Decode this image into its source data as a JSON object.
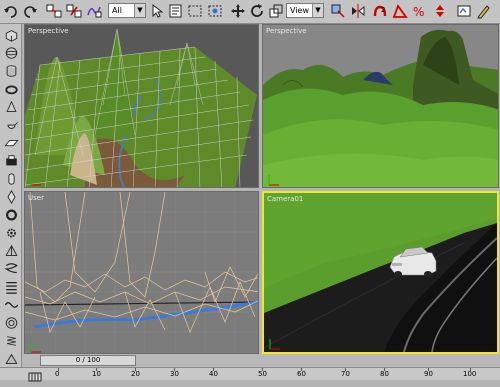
{
  "toolbar": {
    "selection_filter": "All",
    "reference_coord": "View",
    "icons": [
      "undo-icon",
      "redo-icon",
      "select-link-icon",
      "unlink-icon",
      "bind-space-warp-icon",
      "select-object-icon",
      "select-by-name-icon",
      "rectangle-region-icon",
      "window-crossing-icon",
      "move-icon",
      "rotate-icon",
      "scale-icon",
      "pivot-icon",
      "mirror-icon",
      "align-icon",
      "snap-icon",
      "angle-snap-icon",
      "percent-snap-icon",
      "spinner-snap-icon",
      "named-selection-icon"
    ]
  },
  "viewports": {
    "top_left": {
      "label": "Perspective"
    },
    "top_right": {
      "label": "Perspective"
    },
    "bottom_left": {
      "label": "User"
    },
    "bottom_right": {
      "label": "Camera01"
    }
  },
  "timeline": {
    "frame_display": "0 / 100",
    "ruler_labels": [
      "0",
      "10",
      "20",
      "30",
      "40",
      "50",
      "60",
      "70",
      "80",
      "90",
      "100"
    ]
  },
  "colors": {
    "active_viewport_border": "#f0e830",
    "terrain_green": "#5e9a2a",
    "wire_color": "#e8c89a"
  }
}
